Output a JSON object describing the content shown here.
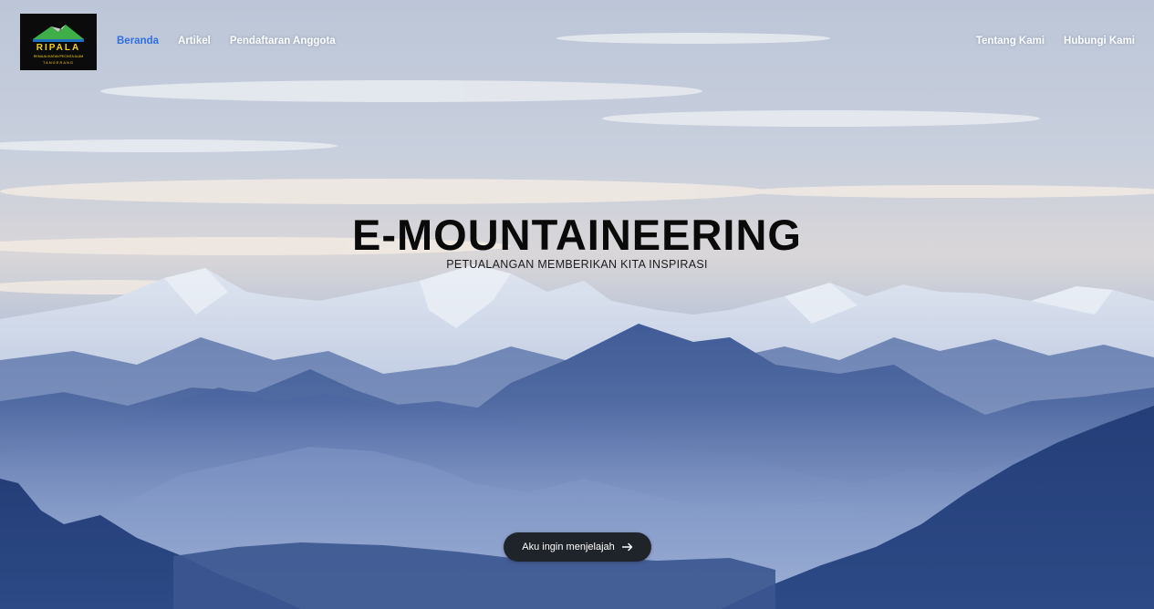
{
  "nav": {
    "logo": {
      "icon": "mountain-logo-icon",
      "text_top": "RIPALA",
      "text_ring": "REMAJA IKATAN PECINTA ALAM",
      "text_bottom": "TANGERANG"
    },
    "left_links": [
      {
        "label": "Beranda",
        "active": true
      },
      {
        "label": "Artikel",
        "active": false
      },
      {
        "label": "Pendaftaran Anggota",
        "active": false
      }
    ],
    "right_links": [
      {
        "label": "Tentang Kami"
      },
      {
        "label": "Hubungi Kami"
      }
    ]
  },
  "hero": {
    "title": "E-MOUNTAINEERING",
    "subtitle": "PETUALANGAN MEMBERIKAN KITA INSPIRASI",
    "background": "mountain-range-photo",
    "cta": {
      "label": "Aku ingin menjelajah",
      "icon": "arrow-right-icon"
    }
  },
  "colors": {
    "active_link": "#2f6fe0",
    "cta_bg": "#1f242b",
    "title": "#0a0a0a"
  }
}
